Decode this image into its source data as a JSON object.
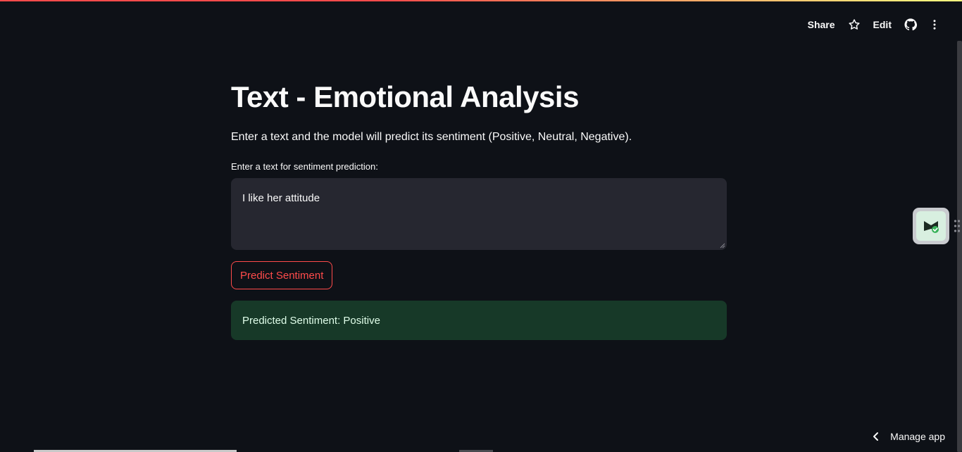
{
  "toolbar": {
    "share_label": "Share",
    "edit_label": "Edit",
    "icons": [
      "star-icon",
      "github-icon",
      "kebab-menu-icon"
    ]
  },
  "main": {
    "title": "Text - Emotional Analysis",
    "subtitle": "Enter a text and the model will predict its sentiment (Positive, Neutral, Negative).",
    "input_label": "Enter a text for sentiment prediction:",
    "input_value": "I like her attitude",
    "predict_button_label": "Predict Sentiment",
    "result_text": "Predicted Sentiment: Positive"
  },
  "footer": {
    "manage_app_label": "Manage app"
  },
  "colors": {
    "background": "#0e1117",
    "accent": "#ff4b4b",
    "input_background": "#262730",
    "success_background": "#173928",
    "success_text": "#dffde9"
  }
}
